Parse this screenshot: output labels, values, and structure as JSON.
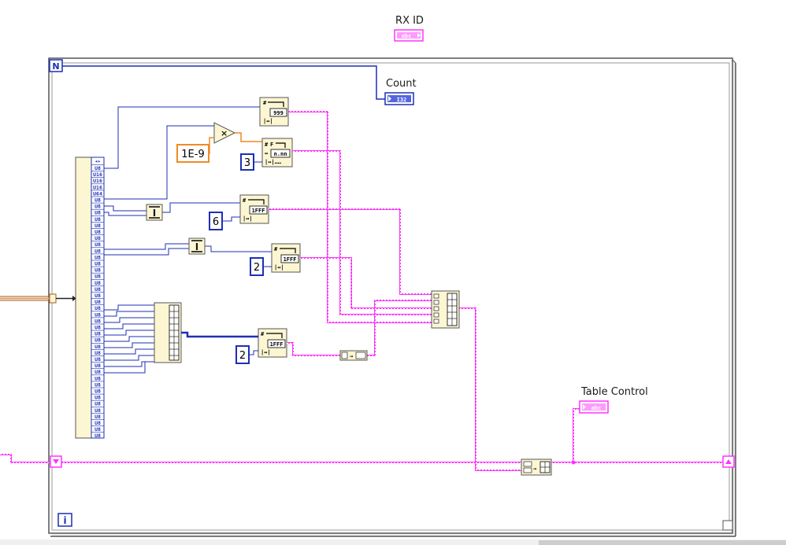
{
  "labels": {
    "rx_id": "RX  ID",
    "count": "Count",
    "table_control": "Table Control"
  },
  "terminals": {
    "rx_id": "abc",
    "count": "I32",
    "table_control": "abc"
  },
  "loop": {
    "count_terminal": "N",
    "iteration_terminal": "i"
  },
  "constants": {
    "multiplier": "1E-9",
    "precision": "3",
    "width_6": "6",
    "width_2a": "2",
    "width_2b": "2"
  },
  "format_icons": {
    "dec": "999",
    "frac": "n.nn",
    "hex_a": "1FFF",
    "hex_b": "1FFF",
    "hex_c": "1FFF"
  },
  "unbundle": {
    "header": "◂▸",
    "element_types": [
      "U8",
      "U16",
      "U16",
      "U16",
      "U64",
      "U8",
      "U8",
      "U8",
      "U8",
      "U8",
      "U8",
      "U8",
      "U8",
      "U8",
      "U8",
      "U8",
      "U8",
      "U8",
      "U8",
      "U8",
      "U8",
      "U8",
      "U8",
      "U8",
      "U8",
      "U8",
      "U8",
      "U8",
      "U8",
      "U8",
      "U8",
      "U8",
      "U8",
      "U8",
      "U8",
      "U8",
      "U8",
      "U8",
      "U8",
      "U8",
      "U8",
      "U8",
      "U8"
    ]
  },
  "colors": {
    "string_wire": "#ff33ff",
    "numeric_wire": "#1d2fb5",
    "float_wire": "#f08a24",
    "node_fill": "#fcf6d2",
    "loop_frame": "#666666",
    "cluster_wire": "#a65a1e"
  }
}
